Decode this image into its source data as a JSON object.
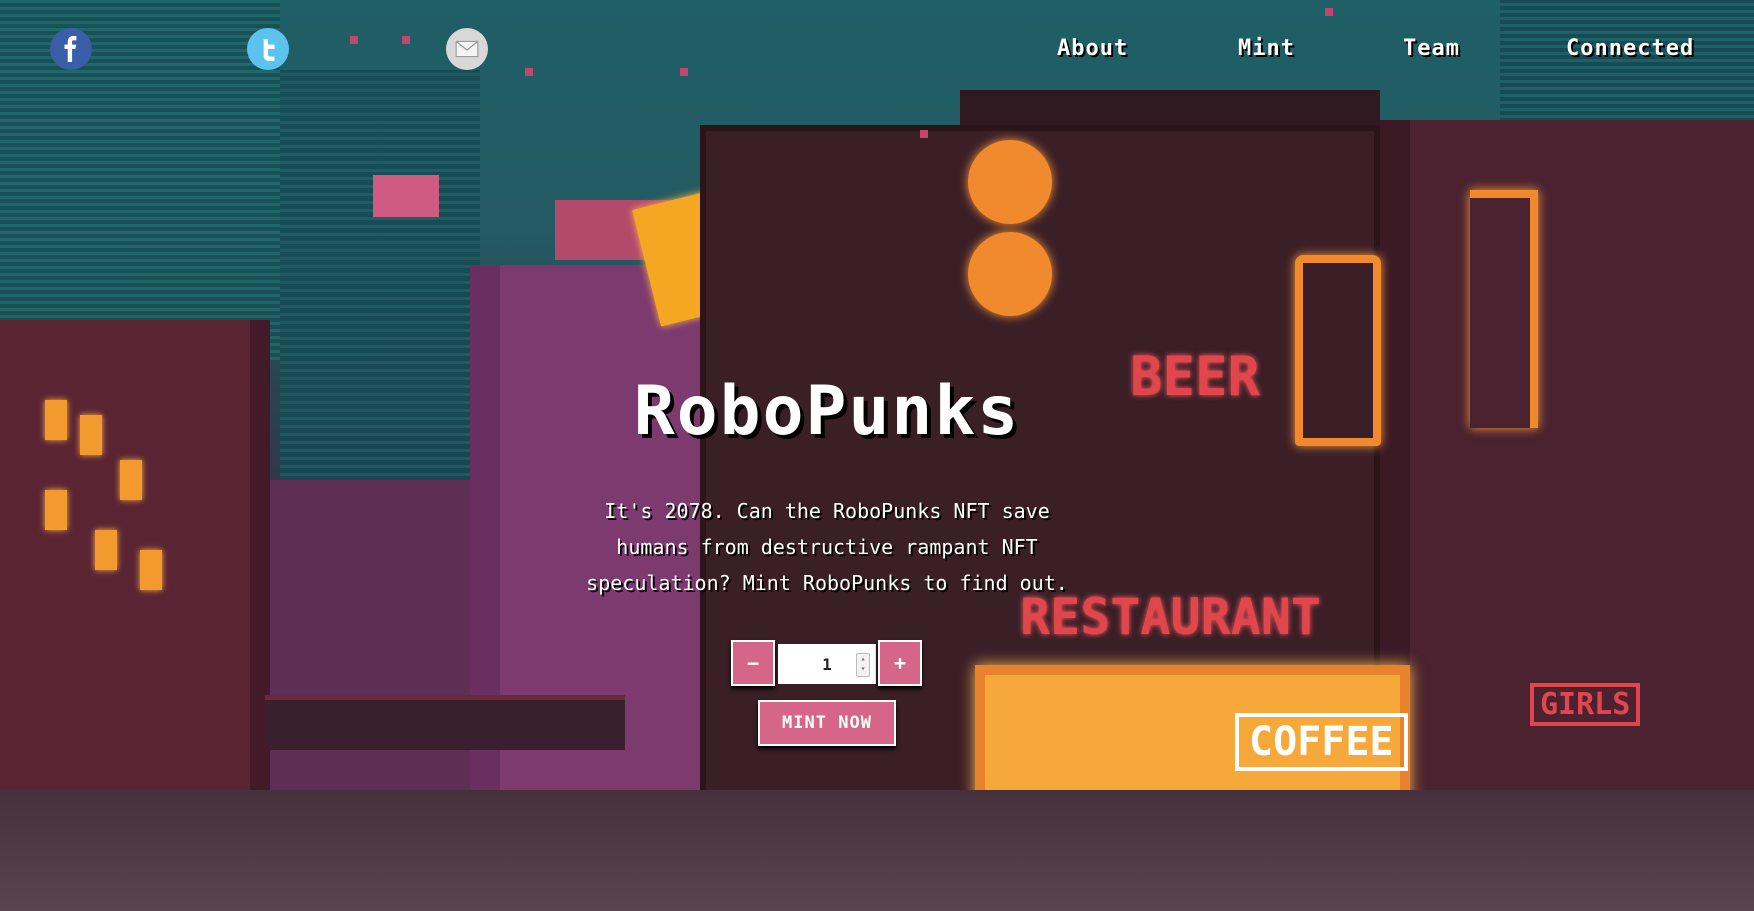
{
  "header": {
    "social": [
      {
        "name": "facebook-icon"
      },
      {
        "name": "twitter-icon"
      },
      {
        "name": "email-icon"
      }
    ],
    "nav": {
      "about": "About",
      "mint": "Mint",
      "team": "Team",
      "connected": "Connected"
    }
  },
  "hero": {
    "title": "RoboPunks",
    "text": "It's 2078. Can the RoboPunks NFT save humans from destructive rampant NFT speculation? Mint RoboPunks to find out."
  },
  "mint": {
    "decrement_label": "−",
    "increment_label": "+",
    "quantity": "1",
    "button_label": "MINT NOW"
  },
  "scene": {
    "sign_beer": "BEER",
    "sign_restaurant": "RESTAURANT",
    "sign_coffee": "COFFEE",
    "sign_girls": "GIRLS"
  },
  "colors": {
    "accent": "#d6658a",
    "sky": "#1f5f66"
  }
}
